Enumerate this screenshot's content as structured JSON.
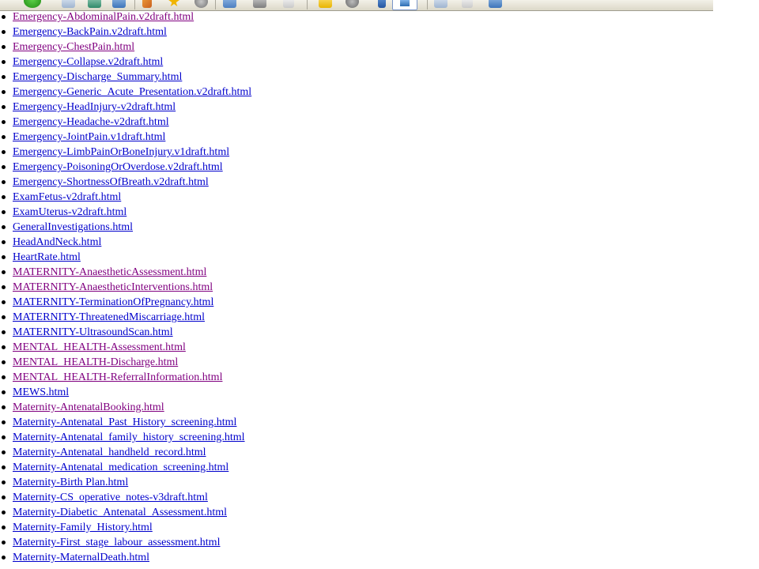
{
  "colors": {
    "link": "#0000cc",
    "visited": "#800080"
  },
  "toolbar": {
    "icons": [
      "go-green-icon",
      "new-page-icon",
      "save-icon",
      "copy-icon",
      "edit-pencil-icon",
      "favorites-star-icon",
      "history-icon",
      "folder-icon",
      "print-icon",
      "document-icon",
      "notes-icon",
      "globe-icon",
      "pin-icon",
      "active-browser-icon",
      "tools-icon",
      "window-icon",
      "network-icon"
    ]
  },
  "links": [
    {
      "text": "Emergency-AbdominalPain.v2draft.html",
      "visited": true
    },
    {
      "text": "Emergency-BackPain.v2draft.html",
      "visited": false
    },
    {
      "text": "Emergency-ChestPain.html",
      "visited": true
    },
    {
      "text": "Emergency-Collapse.v2draft.html",
      "visited": false
    },
    {
      "text": "Emergency-Discharge_Summary.html",
      "visited": false
    },
    {
      "text": "Emergency-Generic_Acute_Presentation.v2draft.html",
      "visited": false
    },
    {
      "text": "Emergency-HeadInjury-v2draft.html",
      "visited": false
    },
    {
      "text": "Emergency-Headache-v2draft.html",
      "visited": false
    },
    {
      "text": "Emergency-JointPain.v1draft.html",
      "visited": false
    },
    {
      "text": "Emergency-LimbPainOrBoneInjury.v1draft.html",
      "visited": false
    },
    {
      "text": "Emergency-PoisoningOrOverdose.v2draft.html",
      "visited": false
    },
    {
      "text": "Emergency-ShortnessOfBreath.v2draft.html",
      "visited": false
    },
    {
      "text": "ExamFetus-v2draft.html",
      "visited": false
    },
    {
      "text": "ExamUterus-v2draft.html",
      "visited": false
    },
    {
      "text": "GeneralInvestigations.html",
      "visited": false
    },
    {
      "text": "HeadAndNeck.html",
      "visited": false
    },
    {
      "text": "HeartRate.html",
      "visited": false
    },
    {
      "text": "MATERNITY-AnaestheticAssessment.html",
      "visited": true
    },
    {
      "text": "MATERNITY-AnaestheticInterventions.html",
      "visited": true
    },
    {
      "text": "MATERNITY-TerminationOfPregnancy.html",
      "visited": false
    },
    {
      "text": "MATERNITY-ThreatenedMiscarriage.html",
      "visited": false
    },
    {
      "text": "MATERNITY-UltrasoundScan.html",
      "visited": false
    },
    {
      "text": "MENTAL_HEALTH-Assessment.html",
      "visited": true
    },
    {
      "text": "MENTAL_HEALTH-Discharge.html",
      "visited": true
    },
    {
      "text": "MENTAL_HEALTH-ReferralInformation.html",
      "visited": true
    },
    {
      "text": "MEWS.html",
      "visited": false
    },
    {
      "text": "Maternity-AntenatalBooking.html",
      "visited": true
    },
    {
      "text": "Maternity-Antenatal_Past_History_screening.html",
      "visited": false
    },
    {
      "text": "Maternity-Antenatal_family_history_screening.html",
      "visited": false
    },
    {
      "text": "Maternity-Antenatal_handheld_record.html",
      "visited": false
    },
    {
      "text": "Maternity-Antenatal_medication_screening.html",
      "visited": false
    },
    {
      "text": "Maternity-Birth Plan.html",
      "visited": false
    },
    {
      "text": "Maternity-CS_operative_notes-v3draft.html",
      "visited": false
    },
    {
      "text": "Maternity-Diabetic_Antenatal_Assessment.html",
      "visited": false
    },
    {
      "text": "Maternity-Family_History.html",
      "visited": false
    },
    {
      "text": "Maternity-First_stage_labour_assessment.html",
      "visited": false
    },
    {
      "text": "Maternity-MaternalDeath.html",
      "visited": false
    }
  ]
}
